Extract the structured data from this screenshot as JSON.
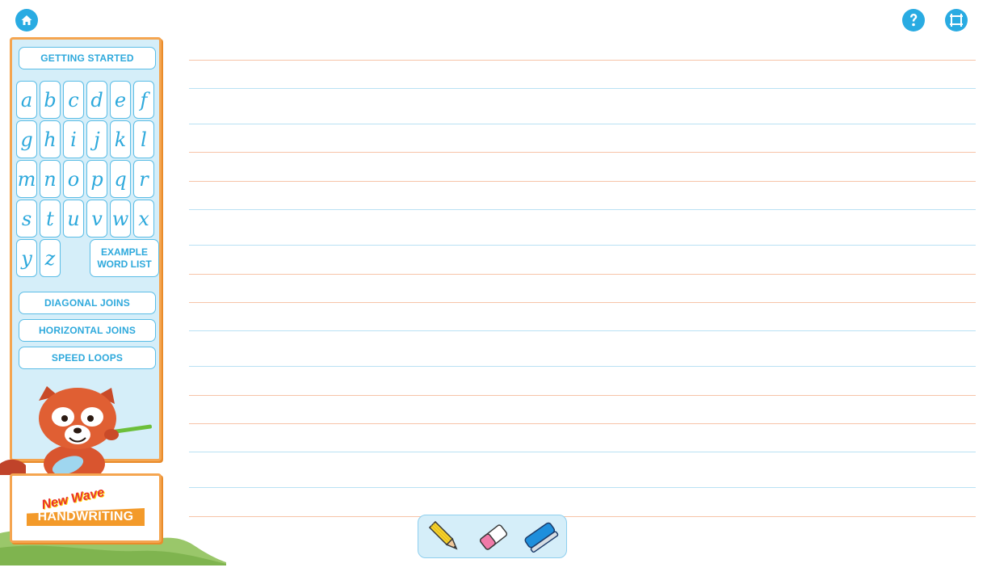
{
  "top_bar": {
    "home_icon": "home-icon",
    "help_icon": "help-icon",
    "fullscreen_icon": "fullscreen-icon"
  },
  "sidebar": {
    "getting_started": "GETTING STARTED",
    "letters": [
      "a",
      "b",
      "c",
      "d",
      "e",
      "f",
      "g",
      "h",
      "i",
      "j",
      "k",
      "l",
      "m",
      "n",
      "o",
      "p",
      "q",
      "r",
      "s",
      "t",
      "u",
      "v",
      "w",
      "x",
      "y",
      "z"
    ],
    "example_line1": "EXAMPLE",
    "example_line2": "WORD LIST",
    "diagonal_joins": "DIAGONAL JOINS",
    "horizontal_joins": "HORIZONTAL JOINS",
    "speed_loops": "SPEED LOOPS"
  },
  "logo": {
    "new_wave": "New Wave",
    "handwriting": "HANDWRITING"
  },
  "tools": [
    "pencil-tool",
    "eraser-tool",
    "clear-board-tool"
  ],
  "colors": {
    "accent_blue": "#29abe2",
    "panel_bg": "#d5eef9",
    "panel_border": "#f5a550",
    "guide_orange": "#f7c4a8",
    "guide_blue": "#b9e1f4"
  }
}
